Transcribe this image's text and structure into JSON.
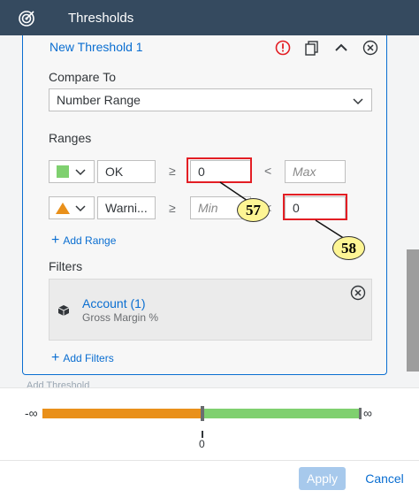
{
  "header": {
    "title": "Thresholds",
    "logo_icon": "target-icon"
  },
  "threshold": {
    "name": "New Threshold 1",
    "icons": [
      "error-icon",
      "copy-icon",
      "chevron-up-icon",
      "close-circle-icon"
    ]
  },
  "compare_to": {
    "label": "Compare To",
    "value": "Number Range"
  },
  "ranges": {
    "label": "Ranges",
    "rows": [
      {
        "color": "#7fd06f",
        "shape": "square",
        "name": "OK",
        "op_left": "≥",
        "from": "0",
        "op_right": "<",
        "to_placeholder": "Max",
        "to": ""
      },
      {
        "color": "#e9901a",
        "shape": "triangle",
        "name": "Warni...",
        "op_left": "≥",
        "from_placeholder": "Min",
        "from": "",
        "op_right": "<",
        "to": "0"
      }
    ],
    "add_label": "Add Range"
  },
  "filters": {
    "label": "Filters",
    "items": [
      {
        "title": "Account (1)",
        "subtitle": "Gross Margin %"
      }
    ],
    "add_label": "Add Filters"
  },
  "callouts": [
    "57",
    "58"
  ],
  "next_threshold_text": "Add Threshold",
  "range_bar": {
    "left_label": "-∞",
    "right_label": "∞",
    "tick_label": "0",
    "segments": [
      {
        "color": "#e9901a",
        "from": "-∞",
        "to": 0
      },
      {
        "color": "#7fd06f",
        "from": 0,
        "to": "∞"
      }
    ]
  },
  "footer": {
    "apply_label": "Apply",
    "cancel_label": "Cancel"
  },
  "colors": {
    "header_bg": "#354a5f",
    "accent": "#0a6ed1",
    "highlight": "#e31e24"
  }
}
